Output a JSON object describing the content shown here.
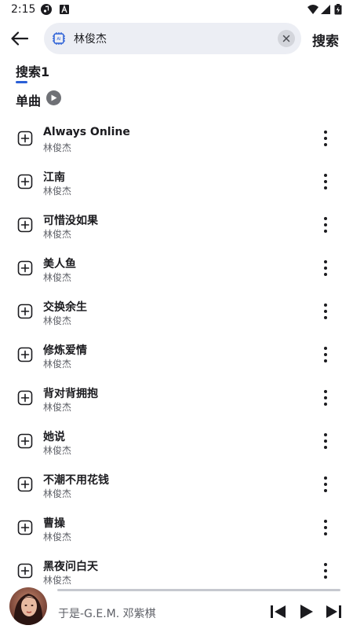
{
  "status_bar": {
    "time": "2:15",
    "left_icons": [
      "music-note-icon",
      "font-a-icon"
    ],
    "right_icons": [
      "wifi-icon",
      "cell-signal-icon",
      "battery-icon"
    ]
  },
  "search": {
    "value": "林俊杰",
    "chip_icon": "ai-chip-icon",
    "clear_icon": "close-icon",
    "submit_label": "搜索"
  },
  "tabs": [
    {
      "label": "搜索1",
      "active": true
    }
  ],
  "section": {
    "title": "单曲"
  },
  "songs": [
    {
      "title": "Always Online",
      "artist": "林俊杰"
    },
    {
      "title": "江南",
      "artist": "林俊杰"
    },
    {
      "title": "可惜没如果",
      "artist": "林俊杰"
    },
    {
      "title": "美人鱼",
      "artist": "林俊杰"
    },
    {
      "title": "交换余生",
      "artist": "林俊杰"
    },
    {
      "title": "修炼爱情",
      "artist": "林俊杰"
    },
    {
      "title": "背对背拥抱",
      "artist": "林俊杰"
    },
    {
      "title": "她说",
      "artist": "林俊杰"
    },
    {
      "title": "不潮不用花钱",
      "artist": "林俊杰"
    },
    {
      "title": "曹操",
      "artist": "林俊杰"
    },
    {
      "title": "黑夜问白天",
      "artist": "林俊杰"
    }
  ],
  "player": {
    "now_playing": "于是-G.E.M. 邓紫棋",
    "progress": 0.0,
    "controls": [
      "skip-previous-icon",
      "play-icon",
      "skip-next-icon"
    ]
  },
  "colors": {
    "accent": "#2a5fd6",
    "search_bg": "#eceef4",
    "text_primary": "#1b1b1f",
    "text_secondary": "#5d5f66"
  }
}
